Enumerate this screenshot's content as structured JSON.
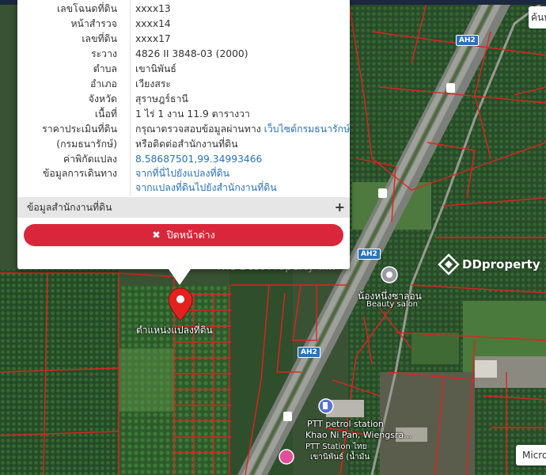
{
  "popup": {
    "rows": [
      {
        "label": "เลขโฉนดที่ดิน",
        "value": "xxxx13"
      },
      {
        "label": "หน้าสำรวจ",
        "value": "xxxx14"
      },
      {
        "label": "เลขที่ดิน",
        "value": "xxxx17"
      },
      {
        "label": "ระวาง",
        "value": "4826 II 3848-03 (2000)"
      },
      {
        "label": "ตำบล",
        "value": "เขานิพันธ์"
      },
      {
        "label": "อำเภอ",
        "value": "เวียงสระ"
      },
      {
        "label": "จังหวัด",
        "value": "สุราษฎร์ธานี"
      },
      {
        "label": "เนื้อที่",
        "value": "1 ไร่ 1 งาน 11.9 ตารางวา"
      },
      {
        "label": "ราคาประเมินที่ดิน",
        "value": "กรุณาตรวจสอบข้อมูลผ่านทาง",
        "link": "เว็บไซต์กรมธนารักษ์"
      },
      {
        "label": "(กรมธนารักษ์)",
        "value": "หรือติดต่อสำนักงานที่ดิน"
      },
      {
        "label": "ค่าพิกัดแปลง",
        "link": "8.58687501,99.34993466"
      },
      {
        "label": "ข้อมูลการเดินทาง",
        "link": "จากที่นี่ไปยังแปลงที่ดิน"
      },
      {
        "label": "",
        "link": "จากแปลงที่ดินไปยังสำนักงานที่ดิน"
      }
    ],
    "office_section": "ข้อมูลสำนักงานที่ดิน",
    "office_expand_icon": "+",
    "close_icon": "✖",
    "close_label": "ปิดหน้าต่าง"
  },
  "map": {
    "parcel_label": "ตำแหน่งแปลงที่ดิน",
    "road_shields": [
      "AH2",
      "AH2",
      "AH2"
    ],
    "poi_salon_name": "น้องหนึ่งซาลอน",
    "poi_salon_sub": "Beauty salon",
    "poi_station_line1": "PTT petrol station",
    "poi_station_line2": "Khao Ni Pan, Wiengsra...",
    "poi_station_line3": "PTT Station ไทย",
    "poi_station_line4": "เขานิพันธ์ (น้ำมัน",
    "search_text": "ค้นห",
    "micro_text": "Micro",
    "watermark_text": "DDproperty",
    "watermark_faint": "The Best Property ห..."
  },
  "colors": {
    "parcel_line": "#e2221f",
    "accent_red": "#d9263a",
    "link_blue": "#2a72b8",
    "road_shield": "#2a73b8"
  }
}
